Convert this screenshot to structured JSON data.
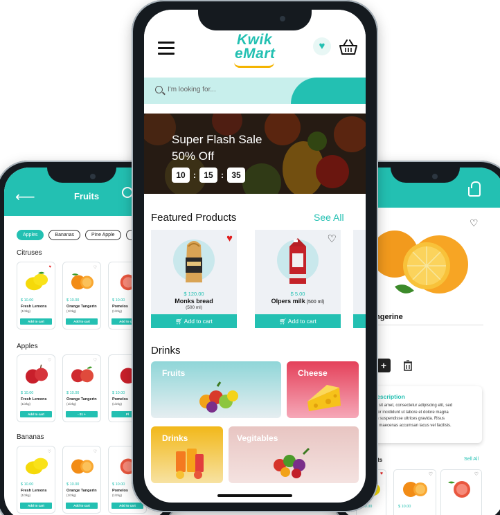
{
  "colors": {
    "accent": "#23c0b2",
    "heart_red": "#e01e1e",
    "dark": "#111111"
  },
  "left_screen": {
    "title": "Fruits",
    "icons": [
      "back-arrow-icon",
      "search-icon"
    ],
    "chips": [
      {
        "label": "Apples",
        "active": true
      },
      {
        "label": "Bananas",
        "active": false
      },
      {
        "label": "Pine Apple",
        "active": false
      },
      {
        "label": "P",
        "active": false
      }
    ],
    "sections": [
      {
        "title": "Citruses",
        "items": [
          {
            "price": "$ 10.00",
            "name": "Fresh Lemons",
            "qty": "(1/2kg)",
            "button": "Add to cart",
            "fruit": "lemon",
            "favorited": true
          },
          {
            "price": "$ 10.00",
            "name": "Orange Tangerin",
            "qty": "(1/2kg)",
            "button": "Add to cart",
            "fruit": "orange",
            "favorited": false
          },
          {
            "price": "$ 10.00",
            "name": "Pomelos",
            "qty": "(1/2kg)",
            "button": "Add to cart",
            "fruit": "grapefruit",
            "favorited": false
          }
        ]
      },
      {
        "title": "Apples",
        "items": [
          {
            "price": "$ 10.00",
            "name": "Fresh Lemons",
            "qty": "(1/2kg)",
            "button": "Add to cart",
            "fruit": "apple",
            "favorited": false
          },
          {
            "price": "$ 10.00",
            "name": "Orange Tangerin",
            "qty": "(1/2kg)",
            "button": "- 01 +",
            "fruit": "apple",
            "favorited": false
          },
          {
            "price": "$ 10.00",
            "name": "Pomelos",
            "qty": "(1/2kg)",
            "button": "Pl",
            "fruit": "apple",
            "favorited": false
          }
        ]
      },
      {
        "title": "Bananas",
        "items": [
          {
            "price": "$ 10.00",
            "name": "Fresh Lemons",
            "qty": "(1/2kg)",
            "button": "Add to cart",
            "fruit": "lemon",
            "favorited": false
          },
          {
            "price": "$ 10.00",
            "name": "Orange Tangerin",
            "qty": "(1/2kg)",
            "button": "Add to cart",
            "fruit": "orange",
            "favorited": false
          },
          {
            "price": "$ 10.00",
            "name": "Pomelos",
            "qty": "(1/2kg)",
            "button": "Add to cart",
            "fruit": "grapefruit",
            "favorited": false
          }
        ]
      }
    ]
  },
  "center_screen": {
    "logo_line1": "Kwik",
    "logo_line2": "eMart",
    "search": {
      "placeholder": "I'm looking for..."
    },
    "banner": {
      "line1": "Super Flash Sale",
      "line2": "50% Off",
      "timer": [
        "10",
        "15",
        "35"
      ],
      "timer_sep": ":"
    },
    "featured": {
      "title": "Featured Products",
      "see_all": "See All",
      "products": [
        {
          "price": "$ 120.00",
          "name": "Monks bread",
          "qty_inline": "",
          "qty_below": "(500 ml)",
          "button": "Add to cart",
          "favorited": true
        },
        {
          "price": "$ 5.00",
          "name": "Olpers milk",
          "qty_inline": " (500 ml)",
          "qty_below": "",
          "button": "Add to cart",
          "favorited": false
        }
      ]
    },
    "drinks": {
      "title": "Drinks",
      "categories": [
        "Fruits",
        "Cheese",
        "Drinks",
        "Vegitables"
      ]
    }
  },
  "right_screen": {
    "product_name": "Tangerine",
    "description_title": "Description",
    "description_text": [
      "dolor sit amet, consectetur adipiscing elit, sed",
      "tempor incididunt ut labore et dolore magna",
      "psum suspendisse ultrices gravida. Risus",
      "verra maecenas accumsan lacus vel facilisis."
    ],
    "products_label": "oducts",
    "sell_all": "Sell All",
    "related": [
      {
        "price": "$ 10.00"
      },
      {
        "price": "$ 10.00"
      }
    ]
  }
}
